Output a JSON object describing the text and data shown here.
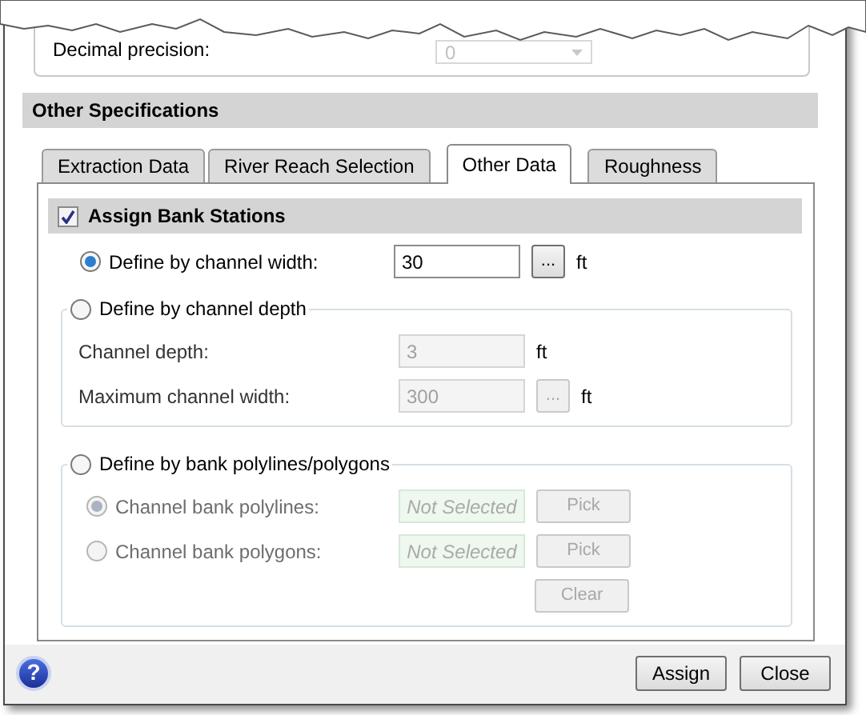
{
  "decimal_precision": {
    "label": "Decimal precision:",
    "value": "0",
    "disabled": true
  },
  "header": "Other Specifications",
  "tabs": [
    {
      "label": "Extraction Data",
      "selected": false
    },
    {
      "label": "River Reach Selection",
      "selected": false
    },
    {
      "label": "Other Data",
      "selected": true
    },
    {
      "label": "Roughness",
      "selected": false
    }
  ],
  "assign_bank_stations": {
    "label": "Assign Bank Stations",
    "checked": true
  },
  "options": [
    {
      "kind": "row",
      "label": "Define by channel width:",
      "selected": true,
      "value": "30",
      "unit": "ft",
      "browse": "...",
      "disabled": false
    },
    {
      "kind": "group",
      "label": "Define by channel depth",
      "selected": false,
      "fields": [
        {
          "label": "Channel depth:",
          "value": "3",
          "unit": "ft",
          "disabled": true
        },
        {
          "label": "Maximum channel width:",
          "value": "300",
          "unit": "ft",
          "browse": "...",
          "disabled": true
        }
      ]
    },
    {
      "kind": "choices",
      "label": "Define by bank polylines/polygons",
      "selected": false,
      "choices": [
        {
          "label": "Channel bank polylines:",
          "selected": true,
          "disabled": true,
          "value": "Not Selected",
          "button": "Pick"
        },
        {
          "label": "Channel bank polygons:",
          "selected": false,
          "disabled": true,
          "value": "Not Selected",
          "button": "Pick"
        }
      ],
      "clear": {
        "label": "Clear",
        "disabled": true
      }
    }
  ],
  "footer": {
    "help": "?",
    "buttons": [
      "Assign",
      "Close"
    ]
  }
}
